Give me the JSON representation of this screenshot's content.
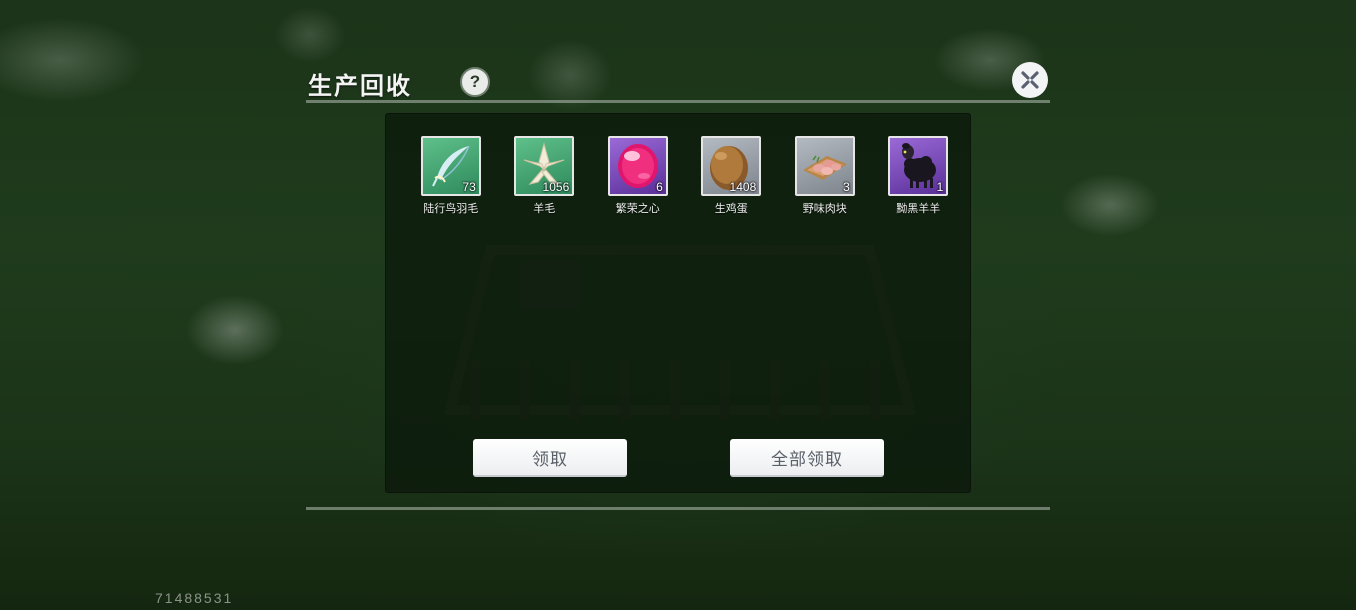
{
  "header": {
    "title": "生产回收",
    "help_glyph": "?"
  },
  "items": [
    {
      "name": "陆行鸟羽毛",
      "count": "73",
      "icon": "feather-icon",
      "bg": "#3d9a6a"
    },
    {
      "name": "羊毛",
      "count": "1056",
      "icon": "wool-icon",
      "bg": "#3d9a6a"
    },
    {
      "name": "繁荣之心",
      "count": "6",
      "icon": "pink-gem-icon",
      "bg": "#7a48b8"
    },
    {
      "name": "生鸡蛋",
      "count": "1408",
      "icon": "egg-icon",
      "bg": "#9aa0a8"
    },
    {
      "name": "野味肉块",
      "count": "3",
      "icon": "meat-icon",
      "bg": "#9aa0a8"
    },
    {
      "name": "黝黑羊羊",
      "count": "1",
      "icon": "black-sheep-icon",
      "bg": "#7a48b8"
    }
  ],
  "buttons": {
    "claim": "领取",
    "claim_all": "全部领取"
  },
  "uid": "71488531"
}
